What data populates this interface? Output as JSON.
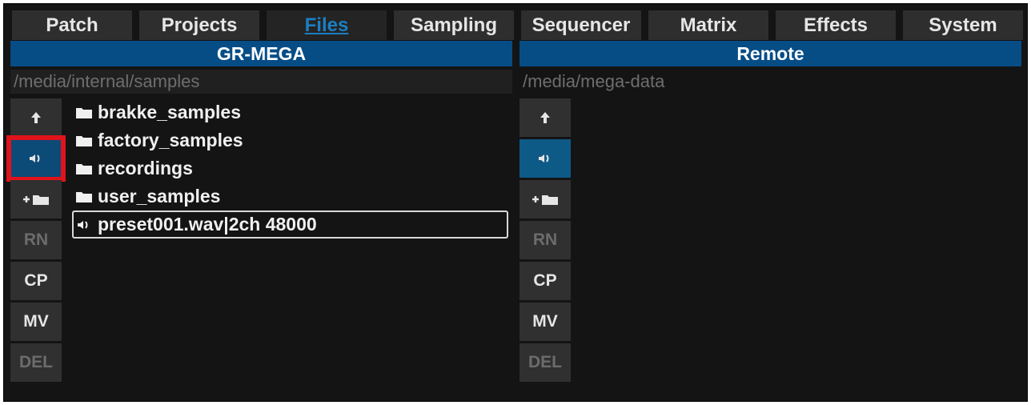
{
  "tabs": [
    {
      "label": "Patch",
      "active": false
    },
    {
      "label": "Projects",
      "active": false
    },
    {
      "label": "Files",
      "active": true
    },
    {
      "label": "Sampling",
      "active": false
    },
    {
      "label": "Sequencer",
      "active": false
    },
    {
      "label": "Matrix",
      "active": false
    },
    {
      "label": "Effects",
      "active": false
    },
    {
      "label": "System",
      "active": false
    }
  ],
  "left": {
    "title": "GR-MEGA",
    "path": "/media/internal/samples",
    "files": [
      {
        "type": "folder",
        "name": "brakke_samples"
      },
      {
        "type": "folder",
        "name": "factory_samples"
      },
      {
        "type": "folder",
        "name": "recordings"
      },
      {
        "type": "folder",
        "name": "user_samples"
      },
      {
        "type": "audio",
        "name": "preset001.wav|2ch 48000",
        "selected": true
      }
    ],
    "buttons": {
      "rn": "RN",
      "cp": "CP",
      "mv": "MV",
      "del": "DEL"
    }
  },
  "right": {
    "title": "Remote",
    "path": "/media/mega-data",
    "buttons": {
      "rn": "RN",
      "cp": "CP",
      "mv": "MV",
      "del": "DEL"
    }
  },
  "colors": {
    "accent": "#064d86",
    "active_tab_text": "#1b7fc4",
    "highlight": "#e0131b"
  }
}
